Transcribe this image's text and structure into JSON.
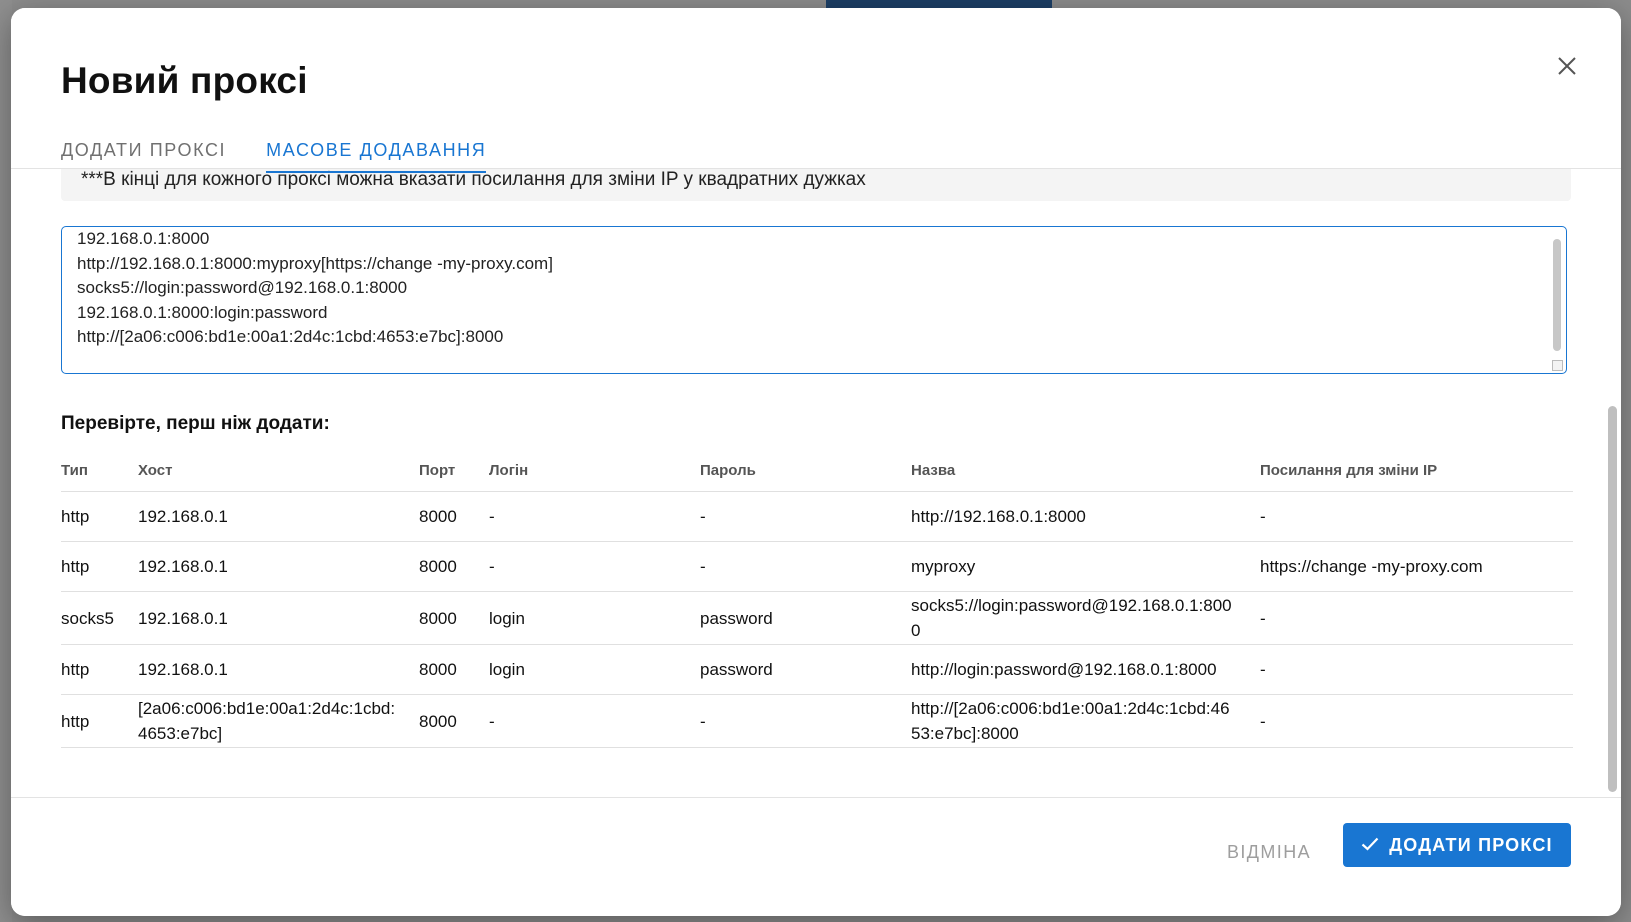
{
  "dialog": {
    "title": "Новий проксі",
    "tabs": [
      {
        "label": "ДОДАТИ ПРОКСІ",
        "active": false
      },
      {
        "label": "МАСОВЕ ДОДАВАННЯ",
        "active": true
      }
    ]
  },
  "note": "***В кінці для кожного проксі можна вказати посилання для зміни IP у квадратних дужках",
  "textarea": {
    "lines": [
      "192.168.0.1:8000",
      "http://192.168.0.1:8000:myproxy[https://change -my-proxy.com]",
      "socks5://login:password@192.168.0.1:8000",
      "192.168.0.1:8000:login:password",
      "http://[2a06:c006:bd1e:00a1:2d4c:1cbd:4653:e7bc]:8000"
    ]
  },
  "preview": {
    "title": "Перевірте, перш ніж додати:",
    "columns": [
      "Тип",
      "Хост",
      "Порт",
      "Логін",
      "Пароль",
      "Назва",
      "Посилання для зміни IP"
    ],
    "rows": [
      [
        "http",
        "192.168.0.1",
        "8000",
        "-",
        "-",
        "http://192.168.0.1:8000",
        "-"
      ],
      [
        "http",
        "192.168.0.1",
        "8000",
        "-",
        "-",
        "myproxy",
        "https://change -my-proxy.com"
      ],
      [
        "socks5",
        "192.168.0.1",
        "8000",
        "login",
        "password",
        "socks5://login:password@192.168.0.1:800\n0",
        "-"
      ],
      [
        "http",
        "192.168.0.1",
        "8000",
        "login",
        "password",
        "http://login:password@192.168.0.1:8000",
        "-"
      ],
      [
        "http",
        "[2a06:c006:bd1e:00a1:2d4c:1cbd:\n4653:e7bc]",
        "8000",
        "-",
        "-",
        "http://[2a06:c006:bd1e:00a1:2d4c:1cbd:46\n53:e7bc]:8000",
        "-"
      ]
    ]
  },
  "footer": {
    "cancel_label": "ВІДМІНА",
    "add_label": "ДОДАТИ ПРОКСІ"
  },
  "colors": {
    "accent": "#1976d2",
    "muted": "#9e9e9e"
  },
  "icons": {
    "close": "close-icon",
    "check": "check-icon"
  }
}
